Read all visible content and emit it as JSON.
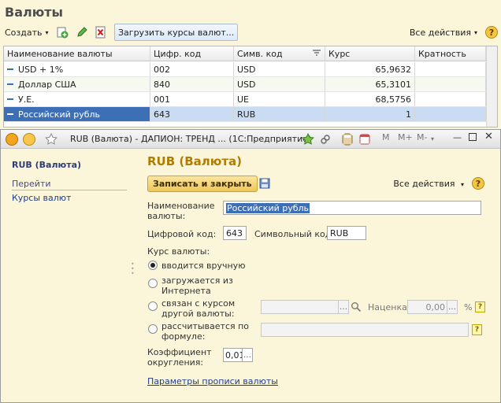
{
  "list": {
    "title": "Валюты",
    "toolbar": {
      "create_label": "Создать",
      "load_label": "Загрузить курсы валют...",
      "all_actions_label": "Все действия",
      "help_glyph": "?"
    },
    "columns": [
      "Наименование валюты",
      "Цифр. код",
      "Симв. код",
      "Курс",
      "Кратность"
    ],
    "rows": [
      {
        "name": "USD + 1%",
        "digital_code": "002",
        "symbol_code": "USD",
        "rate": "65,9632",
        "multiplicity": ""
      },
      {
        "name": "Доллар США",
        "digital_code": "840",
        "symbol_code": "USD",
        "rate": "65,3101",
        "multiplicity": ""
      },
      {
        "name": "У.Е.",
        "digital_code": "001",
        "symbol_code": "UE",
        "rate": "68,5756",
        "multiplicity": ""
      },
      {
        "name": "Российский рубль",
        "digital_code": "643",
        "symbol_code": "RUB",
        "rate": "1",
        "multiplicity": ""
      }
    ]
  },
  "window": {
    "title": "RUB (Валюта) - ДАПИОН: ТРЕНД ...  (1С:Предприятие)",
    "m_buttons": [
      "M",
      "M+",
      "M-"
    ]
  },
  "sidebar": {
    "title": "RUB (Валюта)",
    "goto_label": "Перейти",
    "links": [
      "Курсы валют"
    ]
  },
  "form": {
    "title": "RUB (Валюта)",
    "save_close_label": "Записать и закрыть",
    "all_actions_label": "Все действия",
    "help_glyph": "?",
    "name_label_1": "Наименование",
    "name_label_2": "валюты:",
    "name_value": "Российский рубль",
    "digital_code_label": "Цифровой код:",
    "digital_code_value": "643",
    "symbol_code_label": "Символьный код:",
    "symbol_code_value": "RUB",
    "rate_section_label": "Курс валюты:",
    "rate_options": [
      {
        "line1": "вводится вручную",
        "line2": "",
        "selected": true
      },
      {
        "line1": "загружается из",
        "line2": "Интернета",
        "selected": false
      },
      {
        "line1": "связан с курсом",
        "line2": "другой валюты:",
        "selected": false
      },
      {
        "line1": "рассчитывается по",
        "line2": "формуле:",
        "selected": false
      }
    ],
    "markup_label": "Наценка:",
    "markup_value": "0,00",
    "percent_sign": "%",
    "rounding_label_1": "Коэффициент",
    "rounding_label_2": "округления:",
    "rounding_value": "0,01",
    "params_link": "Параметры прописи валюты"
  },
  "colors": {
    "background": "#fbf6d9",
    "selection": "#3d6fb7",
    "form_title": "#b07d00",
    "link": "#1f3e8a"
  }
}
